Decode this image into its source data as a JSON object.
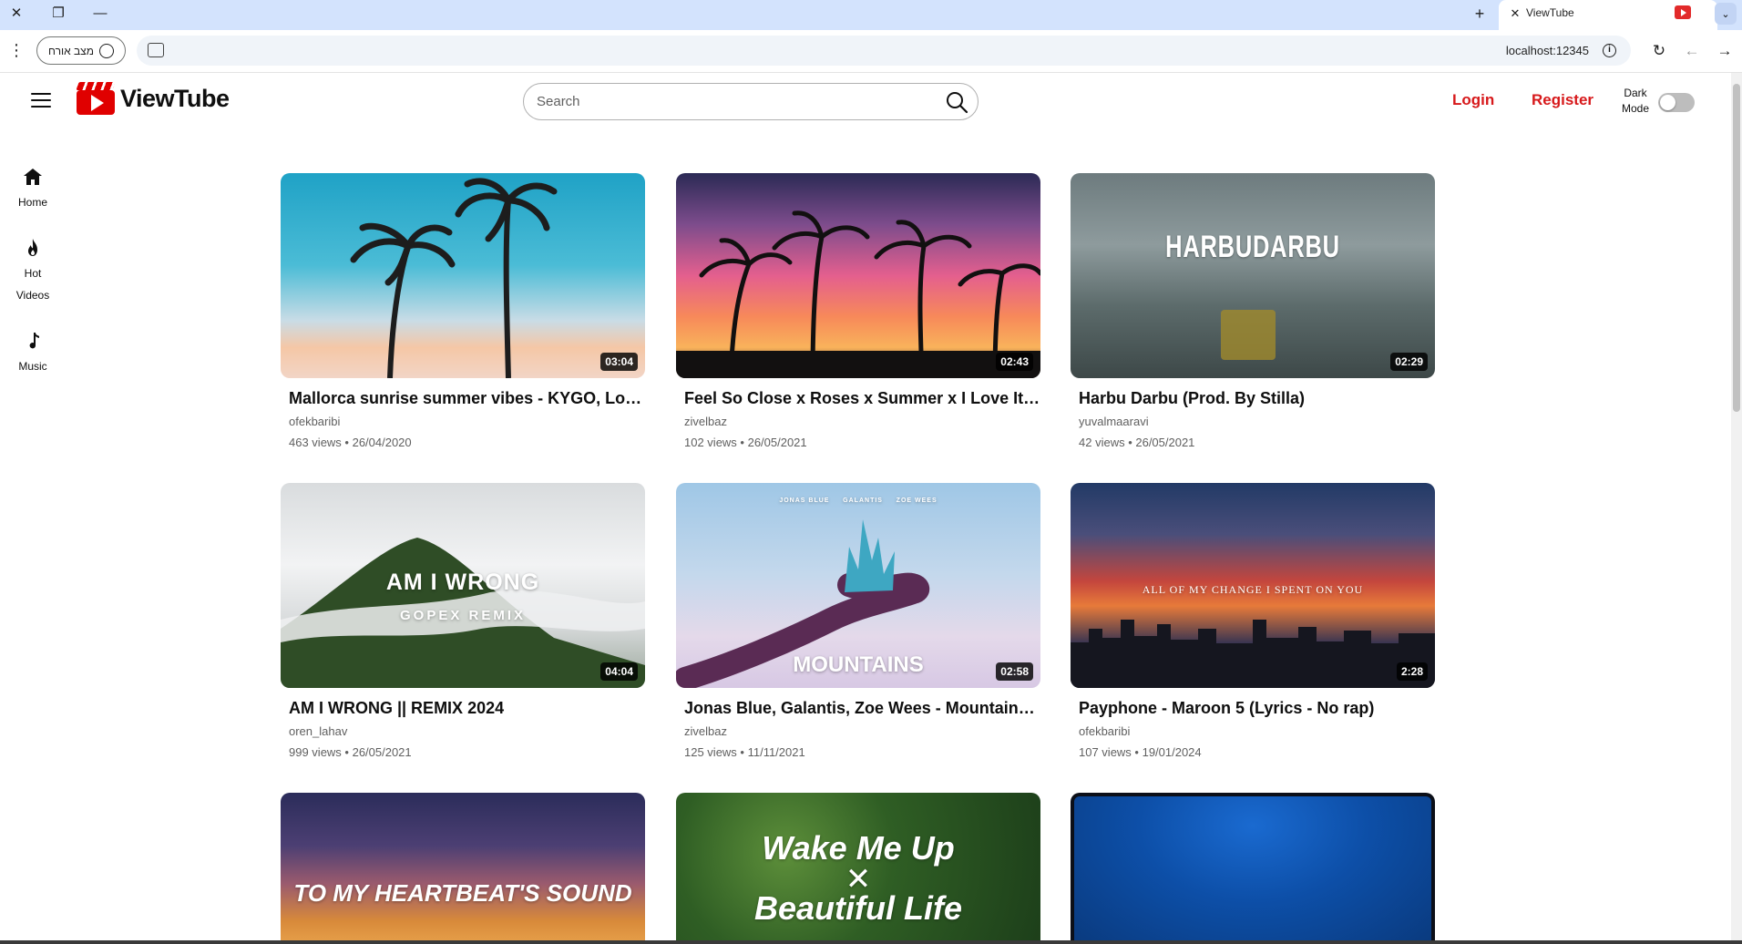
{
  "browser": {
    "tab_title": "ViewTube",
    "profile_label": "מצב אורח",
    "url": "localhost:12345"
  },
  "header": {
    "logo_text": "ViewTube",
    "search_placeholder": "Search",
    "login_label": "Login",
    "register_label": "Register",
    "dark_mode_label": "Dark Mode",
    "dark_mode_on": false,
    "accent_color": "#d7191b"
  },
  "sidebar": {
    "items": [
      {
        "label": "Home",
        "icon": "home-icon"
      },
      {
        "label": "Hot Videos",
        "icon": "fire-icon"
      },
      {
        "label": "Music",
        "icon": "music-note-icon"
      }
    ]
  },
  "videos": [
    {
      "title": "Mallorca sunrise summer vibes - KYGO, Lost Frequencies",
      "channel": "ofekbaribi",
      "meta": "463 views • 26/04/2020",
      "duration": "03:04",
      "thumb_text": ""
    },
    {
      "title": "Feel So Close x Roses x Summer x I Love It (Remix)",
      "channel": "zivelbaz",
      "meta": "102 views • 26/05/2021",
      "duration": "02:43",
      "thumb_text": ""
    },
    {
      "title": "Harbu Darbu (Prod. By Stilla)",
      "channel": "yuvalmaaravi",
      "meta": "42 views • 26/05/2021",
      "duration": "02:29",
      "thumb_text": "HARBUDARBU"
    },
    {
      "title": "AM I WRONG || REMIX 2024",
      "channel": "oren_lahav",
      "meta": "999 views • 26/05/2021",
      "duration": "04:04",
      "thumb_text": "AM I WRONG",
      "thumb_sub": "GOPEX REMIX"
    },
    {
      "title": "Jonas Blue, Galantis, Zoe Wees - Mountains (Lyrics)",
      "channel": "zivelbaz",
      "meta": "125 views • 11/11/2021",
      "duration": "02:58",
      "thumb_text": "MOUNTAINS",
      "thumb_sub": "JONAS BLUE     GALANTIS     ZOE WEES"
    },
    {
      "title": "Payphone - Maroon 5 (Lyrics - No rap)",
      "channel": "ofekbaribi",
      "meta": "107 views • 19/01/2024",
      "duration": "2:28",
      "thumb_text": "ALL OF MY CHANGE I SPENT ON YOU"
    },
    {
      "title": "",
      "channel": "",
      "meta": "",
      "duration": "",
      "thumb_text": "TO MY HEARTBEAT'S SOUND"
    },
    {
      "title": "",
      "channel": "",
      "meta": "",
      "duration": "",
      "thumb_text": "Wake Me Up",
      "thumb_sub": "Beautiful Life"
    },
    {
      "title": "",
      "channel": "",
      "meta": "",
      "duration": "",
      "thumb_text": ""
    }
  ]
}
